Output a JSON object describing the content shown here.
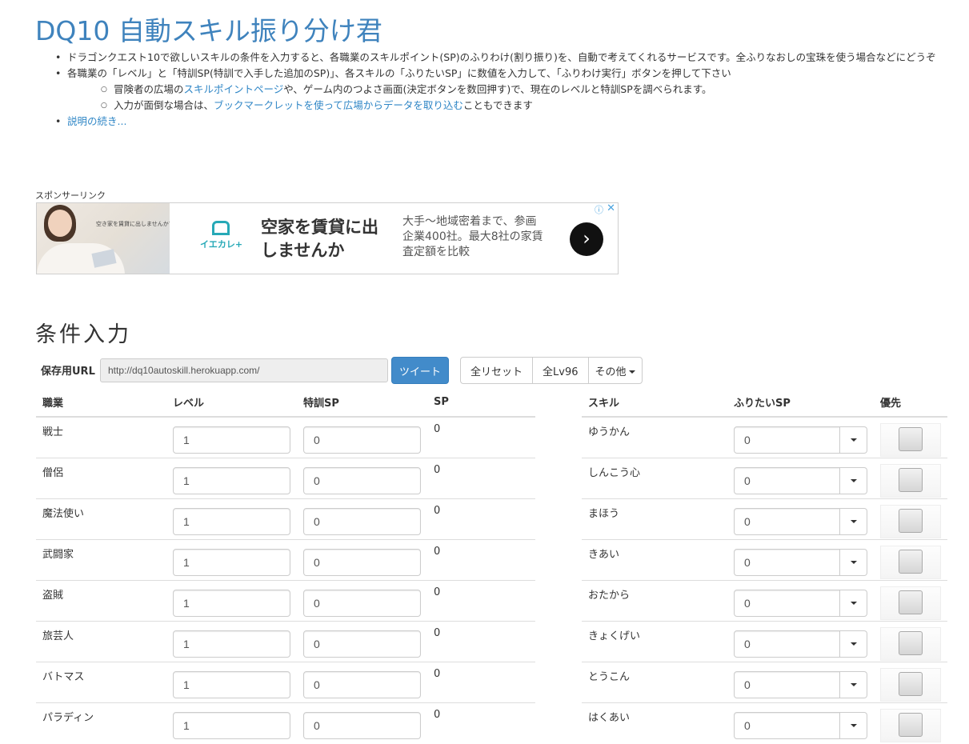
{
  "title": "DQ10 自動スキル振り分け君",
  "description": {
    "item1": "ドラゴンクエスト10で欲しいスキルの条件を入力すると、各職業のスキルポイント(SP)のふりわけ(割り振り)を、自動で考えてくれるサービスです。全ふりなおしの宝珠を使う場合などにどうぞ",
    "item2": "各職業の「レベル」と「特訓SP(特訓で入手した追加のSP)」、各スキルの「ふりたいSP」に数値を入力して、「ふりわけ実行」ボタンを押して下さい",
    "sub1_pre": "冒険者の広場の",
    "sub1_link": "スキルポイントページ",
    "sub1_post": "や、ゲーム内のつよさ画面(決定ボタンを数回押す)で、現在のレベルと特訓SPを調べられます。",
    "sub2_pre": "入力が面倒な場合は、",
    "sub2_link": "ブックマークレットを使って広場からデータを取り込む",
    "sub2_post": "こともできます",
    "more_link": "説明の続き..."
  },
  "sponsor_label": "スポンサーリンク",
  "ad": {
    "photo_text": "空き家を賃貸に出しませんか?",
    "logo_text": "イエカレ+",
    "headline": "空家を賃貸に出しませんか",
    "body": "大手〜地域密着まで、参画企業400社。最大8社の家賃査定額を比較",
    "go": "›",
    "info": "ⓘ",
    "close": "✕"
  },
  "section_title": "条件入力",
  "url": {
    "label": "保存用URL",
    "value": "http://dq10autoskill.herokuapp.com/"
  },
  "buttons": {
    "tweet": "ツイート",
    "reset_all": "全リセット",
    "all_lv96": "全Lv96",
    "other": "その他"
  },
  "jobs_table": {
    "headers": [
      "職業",
      "レベル",
      "特訓SP",
      "SP"
    ],
    "rows": [
      {
        "job": "戦士",
        "level": "1",
        "training_sp": "0",
        "sp": "0"
      },
      {
        "job": "僧侶",
        "level": "1",
        "training_sp": "0",
        "sp": "0"
      },
      {
        "job": "魔法使い",
        "level": "1",
        "training_sp": "0",
        "sp": "0"
      },
      {
        "job": "武闘家",
        "level": "1",
        "training_sp": "0",
        "sp": "0"
      },
      {
        "job": "盗賊",
        "level": "1",
        "training_sp": "0",
        "sp": "0"
      },
      {
        "job": "旅芸人",
        "level": "1",
        "training_sp": "0",
        "sp": "0"
      },
      {
        "job": "バトマス",
        "level": "1",
        "training_sp": "0",
        "sp": "0"
      },
      {
        "job": "パラディン",
        "level": "1",
        "training_sp": "0",
        "sp": "0"
      }
    ]
  },
  "skills_table": {
    "headers": [
      "スキル",
      "ふりたいSP",
      "優先"
    ],
    "rows": [
      {
        "skill": "ゆうかん",
        "desired_sp": "0"
      },
      {
        "skill": "しんこう心",
        "desired_sp": "0"
      },
      {
        "skill": "まほう",
        "desired_sp": "0"
      },
      {
        "skill": "きあい",
        "desired_sp": "0"
      },
      {
        "skill": "おたから",
        "desired_sp": "0"
      },
      {
        "skill": "きょくげい",
        "desired_sp": "0"
      },
      {
        "skill": "とうこん",
        "desired_sp": "0"
      },
      {
        "skill": "はくあい",
        "desired_sp": "0"
      }
    ]
  },
  "colors": {
    "title": "#3f83bd",
    "link": "#2f86c6",
    "primary_button": "#428bca"
  }
}
